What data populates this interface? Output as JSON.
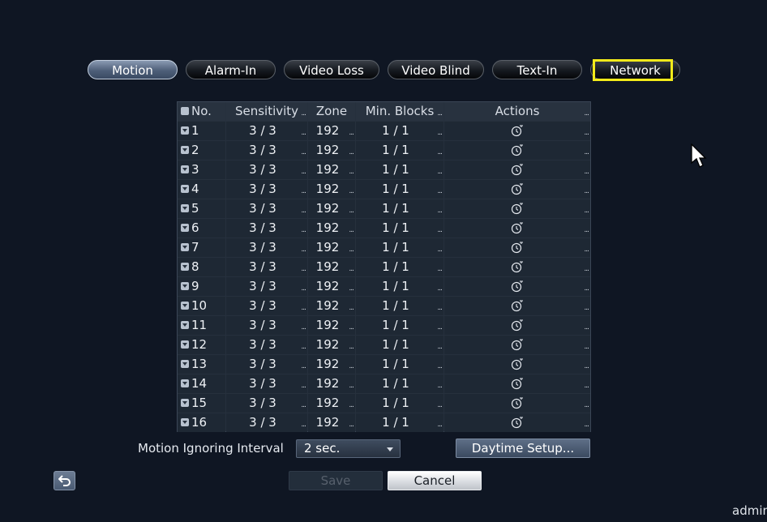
{
  "tabs": [
    {
      "label": "Motion",
      "active": true
    },
    {
      "label": "Alarm-In",
      "active": false
    },
    {
      "label": "Video Loss",
      "active": false
    },
    {
      "label": "Video Blind",
      "active": false
    },
    {
      "label": "Text-In",
      "active": false
    },
    {
      "label": "Network",
      "active": false,
      "highlighted": true
    }
  ],
  "table": {
    "headers": {
      "no": "No.",
      "sensitivity": "Sensitivity",
      "zone": "Zone",
      "min_blocks": "Min. Blocks",
      "actions": "Actions"
    },
    "rows": [
      {
        "no": "1",
        "sensitivity": "3 / 3",
        "zone": "192",
        "min_blocks": "1 / 1"
      },
      {
        "no": "2",
        "sensitivity": "3 / 3",
        "zone": "192",
        "min_blocks": "1 / 1"
      },
      {
        "no": "3",
        "sensitivity": "3 / 3",
        "zone": "192",
        "min_blocks": "1 / 1"
      },
      {
        "no": "4",
        "sensitivity": "3 / 3",
        "zone": "192",
        "min_blocks": "1 / 1"
      },
      {
        "no": "5",
        "sensitivity": "3 / 3",
        "zone": "192",
        "min_blocks": "1 / 1"
      },
      {
        "no": "6",
        "sensitivity": "3 / 3",
        "zone": "192",
        "min_blocks": "1 / 1"
      },
      {
        "no": "7",
        "sensitivity": "3 / 3",
        "zone": "192",
        "min_blocks": "1 / 1"
      },
      {
        "no": "8",
        "sensitivity": "3 / 3",
        "zone": "192",
        "min_blocks": "1 / 1"
      },
      {
        "no": "9",
        "sensitivity": "3 / 3",
        "zone": "192",
        "min_blocks": "1 / 1"
      },
      {
        "no": "10",
        "sensitivity": "3 / 3",
        "zone": "192",
        "min_blocks": "1 / 1"
      },
      {
        "no": "11",
        "sensitivity": "3 / 3",
        "zone": "192",
        "min_blocks": "1 / 1"
      },
      {
        "no": "12",
        "sensitivity": "3 / 3",
        "zone": "192",
        "min_blocks": "1 / 1"
      },
      {
        "no": "13",
        "sensitivity": "3 / 3",
        "zone": "192",
        "min_blocks": "1 / 1"
      },
      {
        "no": "14",
        "sensitivity": "3 / 3",
        "zone": "192",
        "min_blocks": "1 / 1"
      },
      {
        "no": "15",
        "sensitivity": "3 / 3",
        "zone": "192",
        "min_blocks": "1 / 1"
      },
      {
        "no": "16",
        "sensitivity": "3 / 3",
        "zone": "192",
        "min_blocks": "1 / 1"
      }
    ],
    "action_icon": "timer-icon"
  },
  "motion_ignoring_interval": {
    "label": "Motion Ignoring Interval",
    "value": "2 sec."
  },
  "buttons": {
    "daytime_setup": "Daytime Setup...",
    "save": "Save",
    "cancel": "Cancel"
  },
  "user": "admin",
  "colors": {
    "highlight": "#f2ea1a",
    "background": "#0f1623"
  }
}
